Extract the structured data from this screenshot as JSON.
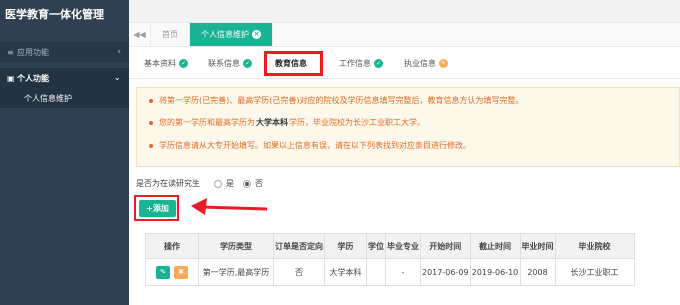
{
  "app": {
    "title": "医学教育一体化管理"
  },
  "sidebar": {
    "main_label": "应用功能",
    "group_label": "个人功能",
    "sub_item": "个人信息维护"
  },
  "tabbar": {
    "home": "首页",
    "active_tab": "个人信息维护"
  },
  "info_tabs": [
    {
      "label": "基本资料",
      "status": "ok"
    },
    {
      "label": "联系信息",
      "status": "ok"
    },
    {
      "label": "教育信息",
      "status": "active"
    },
    {
      "label": "工作信息",
      "status": "ok"
    },
    {
      "label": "执业信息",
      "status": "warn"
    }
  ],
  "notice": {
    "line1": "将第一学历(已完善)、最高学历(已完善)对应的院校及学历信息填写完整后，教育信息方认为填写完整。",
    "line2_prefix": "您的第一学历和最高学历为",
    "line2_bold": "大学本科",
    "line2_suffix": "学历，毕业院校为长沙工业职工大学。",
    "line3": "学历信息请从大专开始填写。如果以上信息有误，请在以下列表找到对应条目进行修改。"
  },
  "graduate": {
    "label": "是否为在读研究生",
    "options": [
      "是",
      "否"
    ],
    "selected": "否"
  },
  "add_button": "+添加",
  "table": {
    "headers": [
      "操作",
      "学历类型",
      "订单是否定向",
      "学历",
      "学位",
      "毕业专业",
      "开始时间",
      "截止时间",
      "毕业时间",
      "毕业院校"
    ],
    "rows": [
      [
        "",
        "第一学历,最高学历",
        "否",
        "大学本科",
        "",
        "-",
        "2017-06-09",
        "2019-06-10",
        "2008",
        "长沙工业职工"
      ]
    ]
  },
  "colors": {
    "accent": "#1ab394",
    "warning": "#f8ac59",
    "highlight": "#e81d26",
    "sidebar": "#2f4050"
  }
}
